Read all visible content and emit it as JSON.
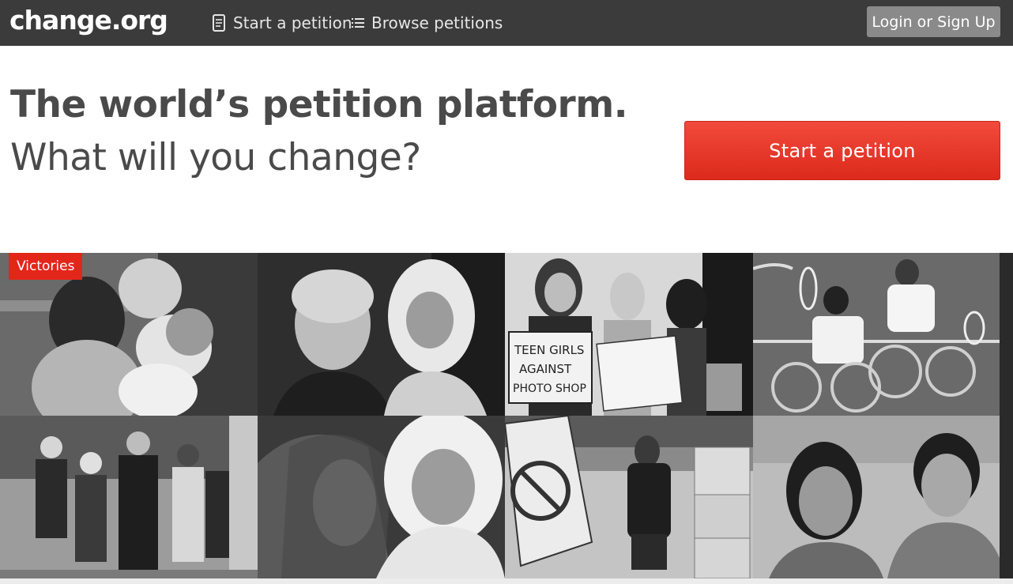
{
  "header": {
    "logo": "change.org",
    "nav": [
      {
        "label": "Start a petition",
        "icon": "document-icon"
      },
      {
        "label": "Browse petitions",
        "icon": "list-icon"
      }
    ],
    "login_label": "Login or Sign Up"
  },
  "hero": {
    "headline": "The world’s petition platform.",
    "subheadline": "What will you change?",
    "cta_label": "Start a petition"
  },
  "gallery": {
    "badge": "Victories",
    "photos": [
      {
        "name": "boxers-photo"
      },
      {
        "name": "diplomats-photo"
      },
      {
        "name": "teen-girls-against-photoshop-photo"
      },
      {
        "name": "wheelchair-tennis-photo"
      },
      {
        "name": "marchers-photo"
      },
      {
        "name": "headscarf-girls-photo"
      },
      {
        "name": "bully-sign-photo"
      },
      {
        "name": "two-women-photo"
      }
    ],
    "sign_text": [
      "TEEN GIRLS",
      "AGAINST",
      "PHOTO SHOP"
    ]
  },
  "colors": {
    "topbar": "#3b3b3b",
    "cta": "#e8342a",
    "badge": "#e3261a",
    "login": "#8a8a8a"
  }
}
